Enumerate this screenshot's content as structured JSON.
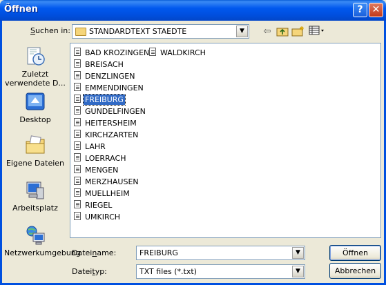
{
  "title": "Öffnen",
  "titlebar": {
    "help_glyph": "?",
    "close_glyph": "✕"
  },
  "lookin": {
    "label_accel": "S",
    "label_rest": "uchen in:",
    "value": "STANDARDTEXT STAEDTE",
    "icons": [
      "back-arrow-icon",
      "up-folder-icon",
      "new-folder-icon",
      "view-menu-icon"
    ]
  },
  "places": [
    {
      "label": "Zuletzt verwendete D...",
      "icon": "recent-documents-icon"
    },
    {
      "label": "Desktop",
      "icon": "desktop-icon"
    },
    {
      "label": "Eigene Dateien",
      "icon": "my-documents-icon"
    },
    {
      "label": "Arbeitsplatz",
      "icon": "my-computer-icon"
    },
    {
      "label": "Netzwerkumgebung",
      "icon": "network-places-icon"
    }
  ],
  "files": [
    "BAD KROZINGEN",
    "BREISACH",
    "DENZLINGEN",
    "EMMENDINGEN",
    "FREIBURG",
    "GUNDELFINGEN",
    "HEITERSHEIM",
    "KIRCHZARTEN",
    "LAHR",
    "LOERRACH",
    "MENGEN",
    "MERZHAUSEN",
    "MUELLHEIM",
    "RIEGEL",
    "UMKIRCH",
    "WALDKIRCH"
  ],
  "selected_file": "FREIBURG",
  "filename": {
    "label_pre": "Datei",
    "label_accel": "n",
    "label_post": "ame:",
    "value": "FREIBURG"
  },
  "filetype": {
    "label_pre": "Datei",
    "label_accel": "t",
    "label_post": "yp:",
    "value": "TXT files (*.txt)"
  },
  "buttons": {
    "open": "Öffnen",
    "cancel": "Abbrechen"
  },
  "colors": {
    "titlebar": "#0050e0",
    "selection": "#316ac5",
    "dialog_bg": "#ece9d8"
  }
}
